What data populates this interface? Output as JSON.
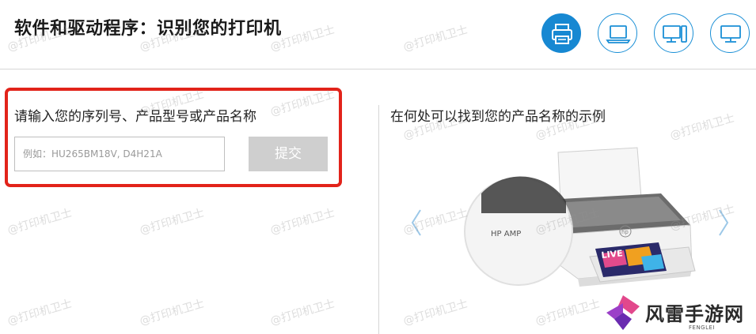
{
  "header": {
    "title": "软件和驱动程序：识别您的打印机",
    "device_types": [
      {
        "icon": "printer-icon",
        "active": true
      },
      {
        "icon": "laptop-icon",
        "active": false
      },
      {
        "icon": "desktop-icon",
        "active": false
      },
      {
        "icon": "monitor-icon",
        "active": false
      }
    ]
  },
  "search": {
    "label": "请输入您的序列号、产品型号或产品名称",
    "placeholder": "例如：HU265BM18V, D4H21A",
    "value": "",
    "submit_label": "提交"
  },
  "example": {
    "title": "在何处可以找到您的产品名称的示例",
    "callout_text": "HP AMP",
    "paper_text": "LIVE"
  },
  "watermark": {
    "text": "@打印机卫士"
  },
  "brand": {
    "name": "风雷手游网",
    "sub": "FENGLEI"
  },
  "colors": {
    "accent": "#1788d2",
    "highlight_border": "#e2231a",
    "button_disabled": "#cfcfcf"
  }
}
